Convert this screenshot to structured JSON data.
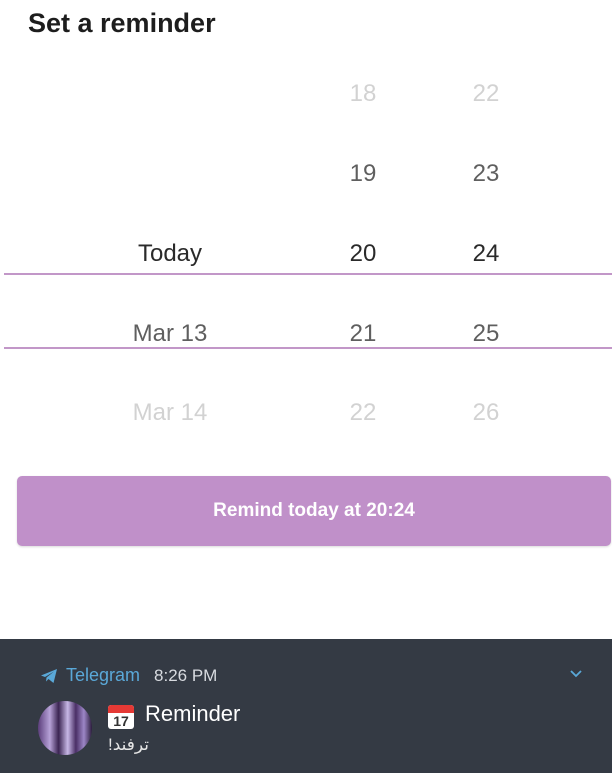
{
  "header": {
    "title": "Set a reminder"
  },
  "picker": {
    "date_column": [
      "",
      "",
      "Today",
      "Mar 13",
      "Mar 14"
    ],
    "hour_column": [
      "18",
      "19",
      "20",
      "21",
      "22"
    ],
    "minute_column": [
      "22",
      "23",
      "24",
      "25",
      "26"
    ],
    "selected_index": 2,
    "accent_color": "#c297c8"
  },
  "action": {
    "remind_label": "Remind today at 20:24",
    "button_color": "#c090c9"
  },
  "notification": {
    "app_icon": "telegram-icon",
    "app_name": "Telegram",
    "time": "8:26 PM",
    "calendar_emoji_day": "17",
    "title": "Reminder",
    "body": "ترفند!",
    "expand_icon": "chevron-down-icon"
  }
}
